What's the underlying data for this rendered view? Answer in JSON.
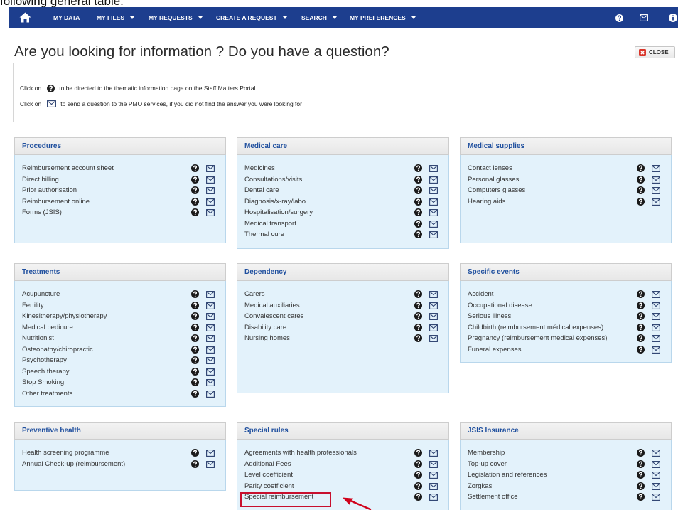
{
  "caption": "following general table:",
  "colors": {
    "nav_bg": "#1d3e8e",
    "panel_title": "#1f4f9e",
    "panel_body": "#e3f2fb",
    "highlight": "#c8102e",
    "arrow": "#d0021b"
  },
  "nav": {
    "home_icon": "home-icon",
    "items": [
      {
        "label": "MY DATA",
        "dropdown": false
      },
      {
        "label": "MY FILES",
        "dropdown": true
      },
      {
        "label": "MY REQUESTS",
        "dropdown": true
      },
      {
        "label": "CREATE A REQUEST",
        "dropdown": true
      },
      {
        "label": "SEARCH",
        "dropdown": true
      },
      {
        "label": "MY PREFERENCES",
        "dropdown": true
      }
    ],
    "right_icons": [
      "question-circle-icon",
      "envelope-icon",
      "info-icon"
    ]
  },
  "page": {
    "title": "Are you looking for information ? Do you have a question?",
    "close_label": "CLOSE",
    "close_icon": "close-icon"
  },
  "info": {
    "line1": {
      "prefix": "Click on",
      "icon": "question-circle-icon",
      "text": "to be directed to the thematic information page on the Staff Matters Portal"
    },
    "line2": {
      "prefix": "Click on",
      "icon": "envelope-icon",
      "text": "to send a question to the PMO services, if you did not find the answer you were looking for"
    }
  },
  "item_icons": {
    "help": "question-circle-icon",
    "mail": "envelope-icon"
  },
  "panels": [
    {
      "title": "Procedures",
      "items": [
        "Reimbursement account sheet",
        "Direct billing",
        "Prior authorisation",
        "Reimbursement online",
        "Forms (JSIS)"
      ]
    },
    {
      "title": "Medical care",
      "items": [
        "Medicines",
        "Consultations/visits",
        "Dental care",
        "Diagnosis/x-ray/labo",
        "Hospitalisation/surgery",
        "Medical transport",
        "Thermal cure"
      ]
    },
    {
      "title": "Medical supplies",
      "items": [
        "Contact lenses",
        "Personal glasses",
        "Computers glasses",
        "Hearing aids"
      ]
    },
    {
      "title": "Treatments",
      "items": [
        "Acupuncture",
        "Fertility",
        "Kinesitherapy/physiotherapy",
        "Medical pedicure",
        "Nutritionist",
        "Osteopathy/chiropractic",
        "Psychotherapy",
        "Speech therapy",
        "Stop Smoking",
        "Other treatments"
      ]
    },
    {
      "title": "Dependency",
      "items": [
        "Carers",
        "Medical auxiliaries",
        "Convalescent cares",
        "Disability care",
        "Nursing homes"
      ]
    },
    {
      "title": "Specific events",
      "items": [
        "Accident",
        "Occupational disease",
        "Serious illness",
        "Childbirth (reimbursement médical expenses)",
        "Pregnancy (reimbursement medical expenses)",
        "Funeral expenses"
      ]
    },
    {
      "title": "Preventive health",
      "items": [
        "Health screening programme",
        "Annual Check-up (reimbursement)"
      ]
    },
    {
      "title": "Special rules",
      "items": [
        "Agreements with health professionals",
        "Additional Fees",
        "Level coefficient",
        "Parity coefficient",
        "Special reimbursement"
      ]
    },
    {
      "title": "JSIS Insurance",
      "items": [
        "Membership",
        "Top-up cover",
        "Legislation and references",
        "Zorgkas",
        "Settlement office"
      ]
    }
  ],
  "highlight": {
    "panel_index": 7,
    "item_index": 4
  }
}
